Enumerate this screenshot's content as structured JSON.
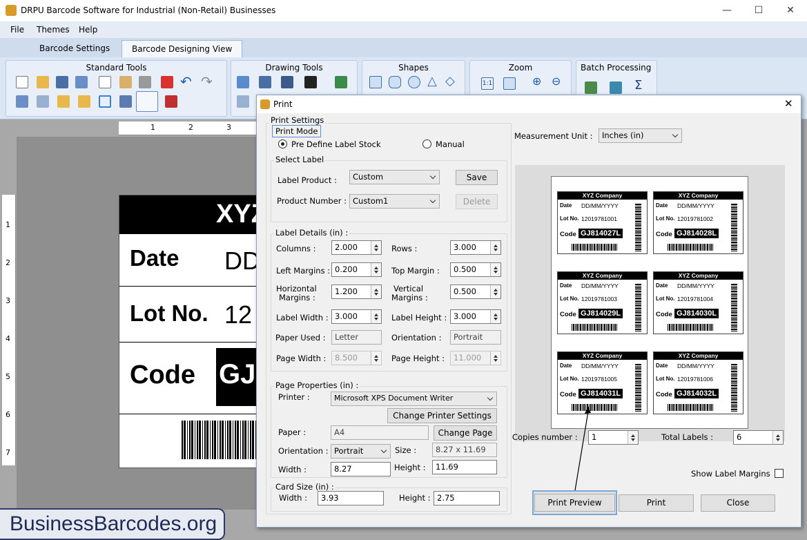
{
  "window": {
    "title": "DRPU Barcode Software for Industrial (Non-Retail) Businesses"
  },
  "menu": [
    "File",
    "Themes",
    "Help"
  ],
  "tabs": [
    "Barcode Settings",
    "Barcode Designing View"
  ],
  "ribbon": {
    "groups": [
      "Standard Tools",
      "Drawing Tools",
      "Shapes",
      "Zoom",
      "Batch Processing"
    ]
  },
  "ruler": {
    "h": [
      "1",
      "2",
      "3"
    ],
    "v": [
      "1",
      "2",
      "3",
      "4",
      "5",
      "6",
      "7"
    ]
  },
  "canvas_label": {
    "header": "XYZ",
    "date_label": "Date",
    "date_value": "DD",
    "lot_label": "Lot No.",
    "lot_value": "12",
    "code_label": "Code",
    "code_value": "GJ"
  },
  "brand": "BusinessBarcodes.org",
  "dialog": {
    "title": "Print",
    "print_settings": "Print Settings",
    "print_mode": "Print Mode",
    "radio_predefine": "Pre Define Label Stock",
    "radio_manual": "Manual",
    "select_label": "Select Label",
    "label_product_lbl": "Label Product :",
    "label_product": "Custom",
    "product_number_lbl": "Product Number :",
    "product_number": "Custom1",
    "save_btn": "Save",
    "delete_btn": "Delete",
    "label_details": "Label Details (in) :",
    "columns_lbl": "Columns :",
    "columns": "2.000",
    "rows_lbl": "Rows :",
    "rows": "3.000",
    "left_margins_lbl": "Left Margins :",
    "left_margins": "0.200",
    "top_margin_lbl": "Top Margin :",
    "top_margin": "0.500",
    "horiz_lbl1": "Horizontal",
    "horiz_lbl2": "Margins :",
    "horiz": "1.200",
    "vert_lbl1": "Vertical",
    "vert_lbl2": "Margins :",
    "vert": "0.500",
    "label_width_lbl": "Label Width :",
    "label_width": "3.000",
    "label_height_lbl": "Label Height :",
    "label_height": "3.000",
    "paper_used_lbl": "Paper Used :",
    "paper_used": "Letter",
    "orientation_lbl": "Orientation :",
    "orientation": "Portrait",
    "page_width_lbl": "Page Width :",
    "page_width": "8.500",
    "page_height_lbl": "Page Height :",
    "page_height": "11.000",
    "page_properties": "Page Properties (in) :",
    "printer_lbl": "Printer :",
    "printer": "Microsoft XPS Document Writer",
    "change_printer_btn": "Change Printer Settings",
    "paper_lbl": "Paper :",
    "paper": "A4",
    "change_page_btn": "Change Page",
    "orient2_lbl": "Orientation :",
    "orient2": "Portrait",
    "size_lbl": "Size :",
    "size": "8.27 x 11.69",
    "pwidth_lbl": "Width :",
    "pwidth": "8.27",
    "pheight_lbl": "Height :",
    "pheight": "11.69",
    "card_size": "Card Size (in) :",
    "cwidth_lbl": "Width :",
    "cwidth": "3.93",
    "cheight_lbl": "Height :",
    "cheight": "2.75",
    "measurement_lbl": "Measurement Unit :",
    "measurement": "Inches (in)",
    "copies_lbl": "Copies number :",
    "copies": "1",
    "total_lbl": "Total Labels :",
    "total": "6",
    "show_margins_lbl": "Show Label Margins",
    "preview_btn": "Print Preview",
    "print_btn": "Print",
    "close_btn": "Close",
    "mini_labels": [
      {
        "company": "XYZ Company",
        "date_lbl": "Date",
        "date": "DD/MM/YYYY",
        "lot_lbl": "Lot No.",
        "lot": "12019781001",
        "code_lbl": "Code",
        "code": "GJ814027L"
      },
      {
        "company": "XYZ Company",
        "date_lbl": "Date",
        "date": "DD/MM/YYYY",
        "lot_lbl": "Lot No.",
        "lot": "12019781002",
        "code_lbl": "Code",
        "code": "GJ814028L"
      },
      {
        "company": "XYZ Company",
        "date_lbl": "Date",
        "date": "DD/MM/YYYY",
        "lot_lbl": "Lot No.",
        "lot": "12019781003",
        "code_lbl": "Code",
        "code": "GJ814029L"
      },
      {
        "company": "XYZ Company",
        "date_lbl": "Date",
        "date": "DD/MM/YYYY",
        "lot_lbl": "Lot No.",
        "lot": "12019781004",
        "code_lbl": "Code",
        "code": "GJ814030L"
      },
      {
        "company": "XYZ Company",
        "date_lbl": "Date",
        "date": "DD/MM/YYYY",
        "lot_lbl": "Lot No.",
        "lot": "12019781005",
        "code_lbl": "Code",
        "code": "GJ814031L"
      },
      {
        "company": "XYZ Company",
        "date_lbl": "Date",
        "date": "DD/MM/YYYY",
        "lot_lbl": "Lot No.",
        "lot": "12019781006",
        "code_lbl": "Code",
        "code": "GJ814032L"
      }
    ]
  }
}
